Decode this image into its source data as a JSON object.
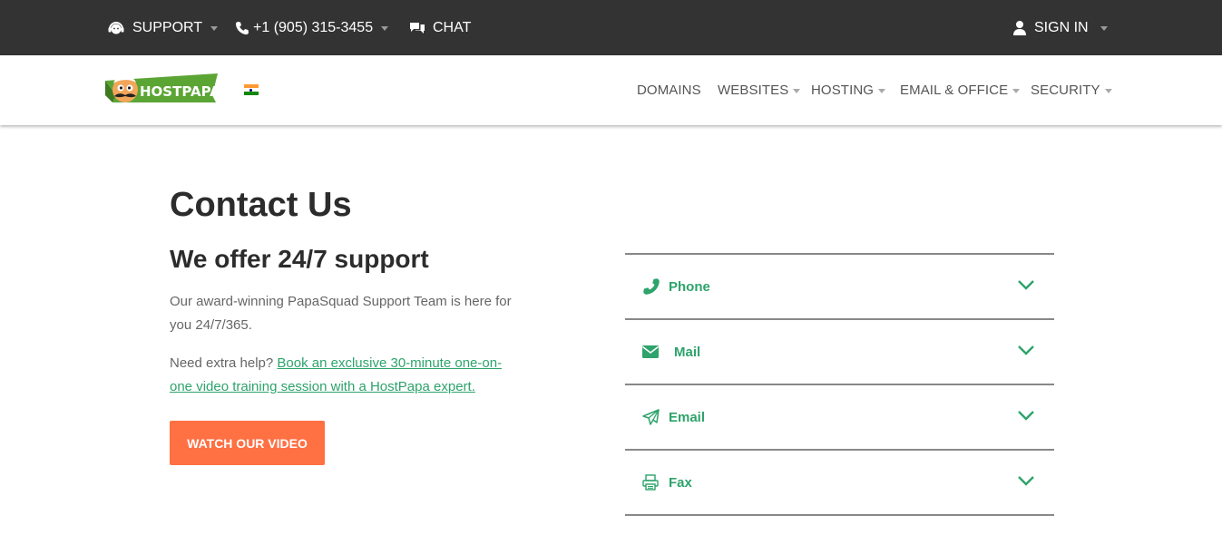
{
  "topbar": {
    "support_label": "SUPPORT",
    "phone_label": "+1 (905) 315-3455",
    "chat_label": "CHAT",
    "signin_label": "SIGN IN"
  },
  "nav": {
    "logo_text": "HOSTPAPA",
    "flag_icon": "india-flag-icon",
    "items": [
      {
        "label": "DOMAINS"
      },
      {
        "label": "WEBSITES"
      },
      {
        "label": "HOSTING"
      },
      {
        "label": "EMAIL & OFFICE"
      },
      {
        "label": "SECURITY"
      }
    ]
  },
  "content": {
    "title": "Contact Us",
    "subtitle": "We offer 24/7 support",
    "para1": "Our award-winning PapaSquad Support Team is here for you 24/7/365.",
    "para2_prefix": "Need extra help? ",
    "para2_link": "Book an exclusive 30-minute one-on-one video training session with a HostPapa expert.",
    "video_button": "WATCH OUR VIDEO"
  },
  "contact_methods": [
    {
      "label": "Phone",
      "icon": "phone-icon"
    },
    {
      "label": "Mail",
      "icon": "envelope-icon"
    },
    {
      "label": "Email",
      "icon": "paper-plane-icon"
    },
    {
      "label": "Fax",
      "icon": "fax-icon"
    }
  ],
  "colors": {
    "topbar_bg": "#333333",
    "accent_green": "#2ea36b",
    "button_orange": "#ff7043"
  }
}
